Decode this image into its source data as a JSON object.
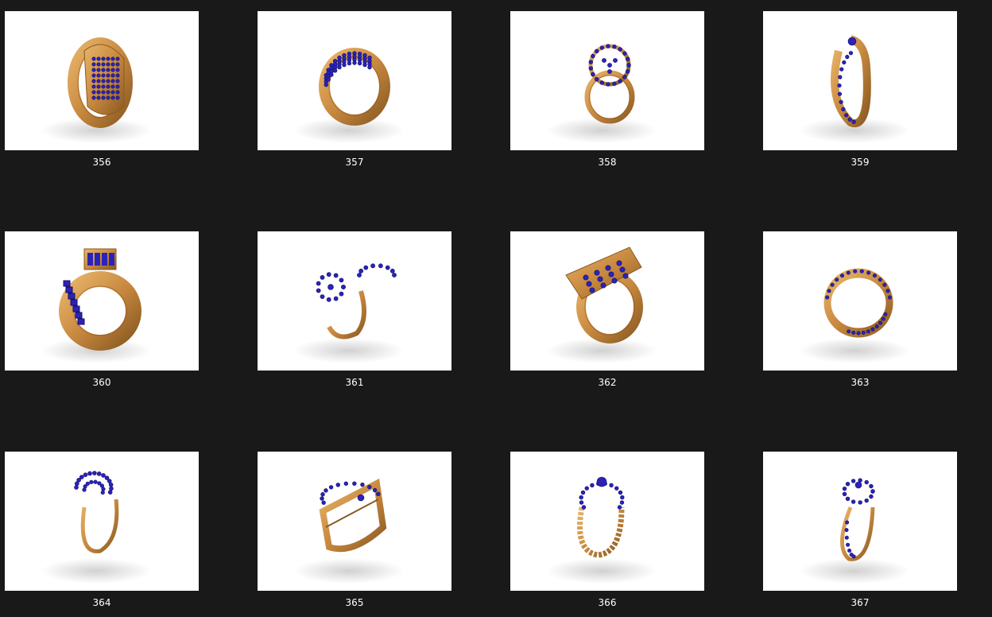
{
  "gallery": {
    "items": [
      {
        "label": "356",
        "style": "wide-pave",
        "image": "gold ring with blue stones"
      },
      {
        "label": "357",
        "style": "band-rows",
        "image": "gold ring with blue stones"
      },
      {
        "label": "358",
        "style": "halo-flower",
        "image": "gold ring with blue stones"
      },
      {
        "label": "359",
        "style": "bypass-solitaire",
        "image": "gold ring with blue stones"
      },
      {
        "label": "360",
        "style": "wide-channel",
        "image": "gold ring with blue stones"
      },
      {
        "label": "361",
        "style": "flower-open",
        "image": "gold ring with blue stones"
      },
      {
        "label": "362",
        "style": "signet-grid",
        "image": "gold ring with blue stones"
      },
      {
        "label": "363",
        "style": "multi-wire",
        "image": "gold ring with blue stones"
      },
      {
        "label": "364",
        "style": "fan-swirl",
        "image": "gold ring with blue stones"
      },
      {
        "label": "365",
        "style": "double-band",
        "image": "gold ring with blue stones"
      },
      {
        "label": "366",
        "style": "rope-solitaire",
        "image": "gold ring with blue stones"
      },
      {
        "label": "367",
        "style": "knot-flower",
        "image": "gold ring with blue stones"
      }
    ]
  },
  "colors": {
    "background": "#191919",
    "thumbnail": "#ffffff",
    "caption": "#ffffff",
    "gold": "#c8893f",
    "gold_dark": "#8a5a22",
    "gold_light": "#e8b56a",
    "stone": "#2b23b8",
    "stone_dark": "#140f6b"
  }
}
